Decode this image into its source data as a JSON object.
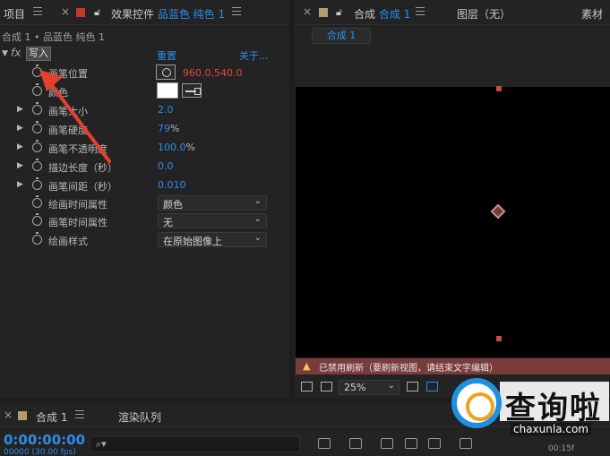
{
  "left_panel": {
    "tab_project": "项目",
    "tab_effects_prefix": "效果控件",
    "tab_effects_layer": "品蓝色 纯色 1",
    "breadcrumb": "合成 1 • 品蓝色 纯色 1",
    "fx": "fx",
    "write_label": "写入",
    "reset_label": "重置",
    "about_label": "关于...",
    "properties": [
      {
        "label": "画笔位置",
        "value": "960.0,540.0"
      },
      {
        "label": "颜色",
        "value": ""
      },
      {
        "label": "画笔大小",
        "value": "2.0"
      },
      {
        "label": "画笔硬度",
        "value": "79",
        "unit": "%"
      },
      {
        "label": "画笔不透明度",
        "value": "100.0",
        "unit": "%"
      },
      {
        "label": "描边长度（秒）",
        "value": "0.0"
      },
      {
        "label": "画笔间距（秒）",
        "value": "0.010"
      },
      {
        "label": "绘画时间属性",
        "dropdown": "颜色"
      },
      {
        "label": "画笔时间属性",
        "dropdown": "无"
      },
      {
        "label": "绘画样式",
        "dropdown": "在原始图像上"
      }
    ]
  },
  "right_panel": {
    "tab_comp_prefix": "合成",
    "tab_comp_name": "合成 1",
    "tab_layer": "图层（无）",
    "tab_footage": "素材",
    "subtab": "合成 1",
    "warning": "已禁用刷新（要刷新视图，请结束文字编辑）",
    "zoom": "25%"
  },
  "bottom_panel": {
    "tab_comp": "合成 1",
    "tab_render": "渲染队列",
    "timecode": "0:00:00:00",
    "frames": "00000 (30.00 fps)",
    "ruler_time": "00:15f"
  },
  "watermark": {
    "title": "查询啦",
    "url": "chaxunla.com"
  },
  "colors": {
    "accent": "#2d8ceb",
    "value_red": "#e2493c",
    "swatch": "#ffffff",
    "warning_bg": "#7a3b3b",
    "arrow": "#e5402f"
  },
  "icons": [
    "close-icon",
    "menu-icon",
    "lock-icon",
    "stopwatch-icon",
    "target-icon",
    "eyedropper-icon",
    "chevron-down-icon",
    "warning-icon",
    "search-icon"
  ]
}
